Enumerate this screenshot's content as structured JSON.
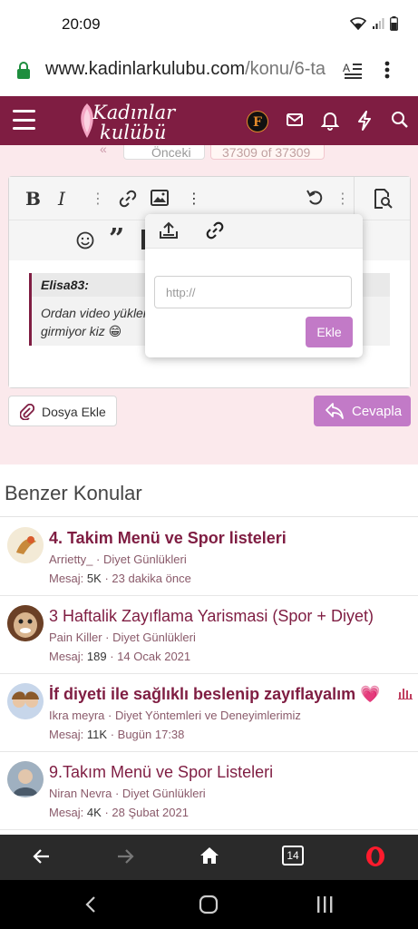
{
  "status": {
    "time": "20:09"
  },
  "browser": {
    "url_main": "www.kadinlarkulubu.com",
    "url_path": "/konu/6-ta",
    "tab_count": "14"
  },
  "site": {
    "logo_line1": "Kadınlar",
    "logo_line2": "kulübü",
    "avatar_letter": "F",
    "accent": "#7f1d42",
    "button_color": "#c27ac7"
  },
  "pager": {
    "prev_label": "Önceki",
    "range_label": "37309 of 37309"
  },
  "editor": {
    "quote_author": "Elisa83:",
    "quote_line1": "Ordan video yükler",
    "quote_line2": "girmiyor kiz 😁"
  },
  "popup": {
    "url_placeholder": "http://",
    "insert_label": "Ekle"
  },
  "actions": {
    "attach_label": "Dosya Ekle",
    "reply_label": "Cevapla"
  },
  "similar": {
    "heading": "Benzer Konular",
    "threads": [
      {
        "title": "4. Takim Menü ve Spor listeleri",
        "bold": true,
        "author": "Arrietty_",
        "forum": "Diyet Günlükleri",
        "replies_label": "Mesaj:",
        "replies": "5K",
        "time": "23 dakika önce"
      },
      {
        "title": "3 Haftalik Zayıflama Yarismasi (Spor + Diyet)",
        "bold": false,
        "author": "Pain Killer",
        "forum": "Diyet Günlükleri",
        "replies_label": "Mesaj:",
        "replies": "189",
        "time": "14 Ocak 2021"
      },
      {
        "title": "İf diyeti ile sağlıklı beslenip zayıflayalım 💗",
        "bold": true,
        "author": "Ikra meyra",
        "forum": "Diyet Yöntemleri ve Deneyimlerimiz",
        "replies_label": "Mesaj:",
        "replies": "11K",
        "time": "Bugün 17:38"
      },
      {
        "title": "9.Takım Menü ve Spor Listeleri",
        "bold": false,
        "author": "Niran Nevra",
        "forum": "Diyet Günlükleri",
        "replies_label": "Mesaj:",
        "replies": "4K",
        "time": "28 Şubat 2021"
      }
    ]
  }
}
